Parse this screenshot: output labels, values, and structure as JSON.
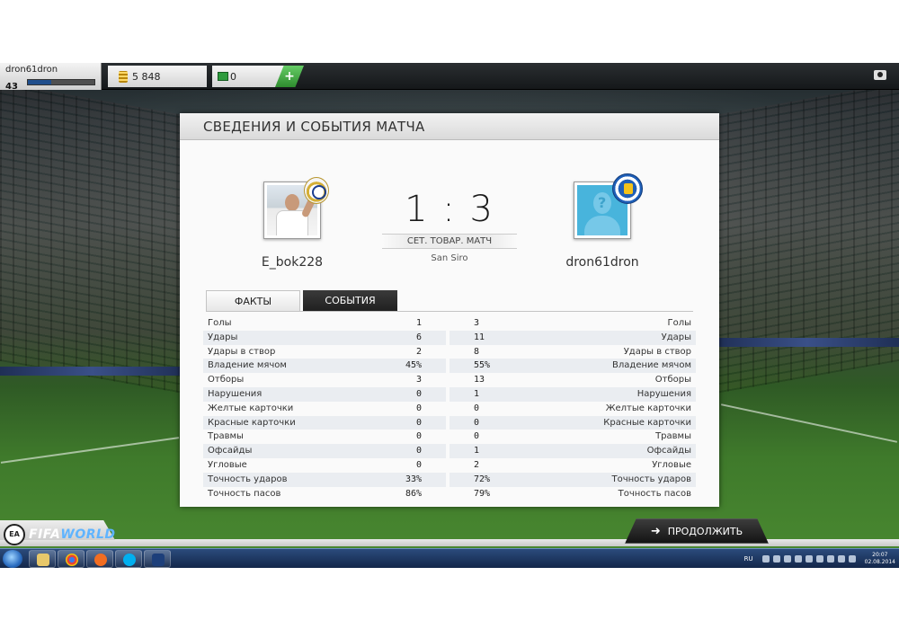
{
  "topbar": {
    "username": "dron61dron",
    "level": "43",
    "coins": "5 848",
    "points": "0",
    "add_label": "+"
  },
  "panel": {
    "title": "СВЕДЕНИЯ И СОБЫТИЯ МАТЧА",
    "home_team": "E_bok228",
    "away_team": "dron61dron",
    "score": "1 : 3",
    "match_type": "СЕТ. ТОВАР. МАТЧ",
    "stadium": "San Siro",
    "tabs": [
      {
        "label": "ФАКТЫ",
        "active": true
      },
      {
        "label": "СОБЫТИЯ",
        "active": false
      }
    ]
  },
  "stats": [
    {
      "label": "Голы",
      "home": "1",
      "away": "3"
    },
    {
      "label": "Удары",
      "home": "6",
      "away": "11"
    },
    {
      "label": "Удары в створ",
      "home": "2",
      "away": "8"
    },
    {
      "label": "Владение мячом",
      "home": "45%",
      "away": "55%"
    },
    {
      "label": "Отборы",
      "home": "3",
      "away": "13"
    },
    {
      "label": "Нарушения",
      "home": "0",
      "away": "1"
    },
    {
      "label": "Желтые карточки",
      "home": "0",
      "away": "0"
    },
    {
      "label": "Красные карточки",
      "home": "0",
      "away": "0"
    },
    {
      "label": "Травмы",
      "home": "0",
      "away": "0"
    },
    {
      "label": "Офсайды",
      "home": "0",
      "away": "1"
    },
    {
      "label": "Угловые",
      "home": "0",
      "away": "2"
    },
    {
      "label": "Точность ударов",
      "home": "33%",
      "away": "72%"
    },
    {
      "label": "Точность пасов",
      "home": "86%",
      "away": "79%"
    }
  ],
  "footer": {
    "logo_text_a": "FIFA",
    "logo_text_b": "WORLD",
    "ea_label": "EA",
    "continue_label": "ПРОДОЛЖИТЬ"
  },
  "taskbar": {
    "lang": "RU",
    "time": "20:07",
    "date": "02.08.2014"
  },
  "icons": {
    "continue": "arrow-right-icon",
    "screenshot": "camera-icon"
  }
}
